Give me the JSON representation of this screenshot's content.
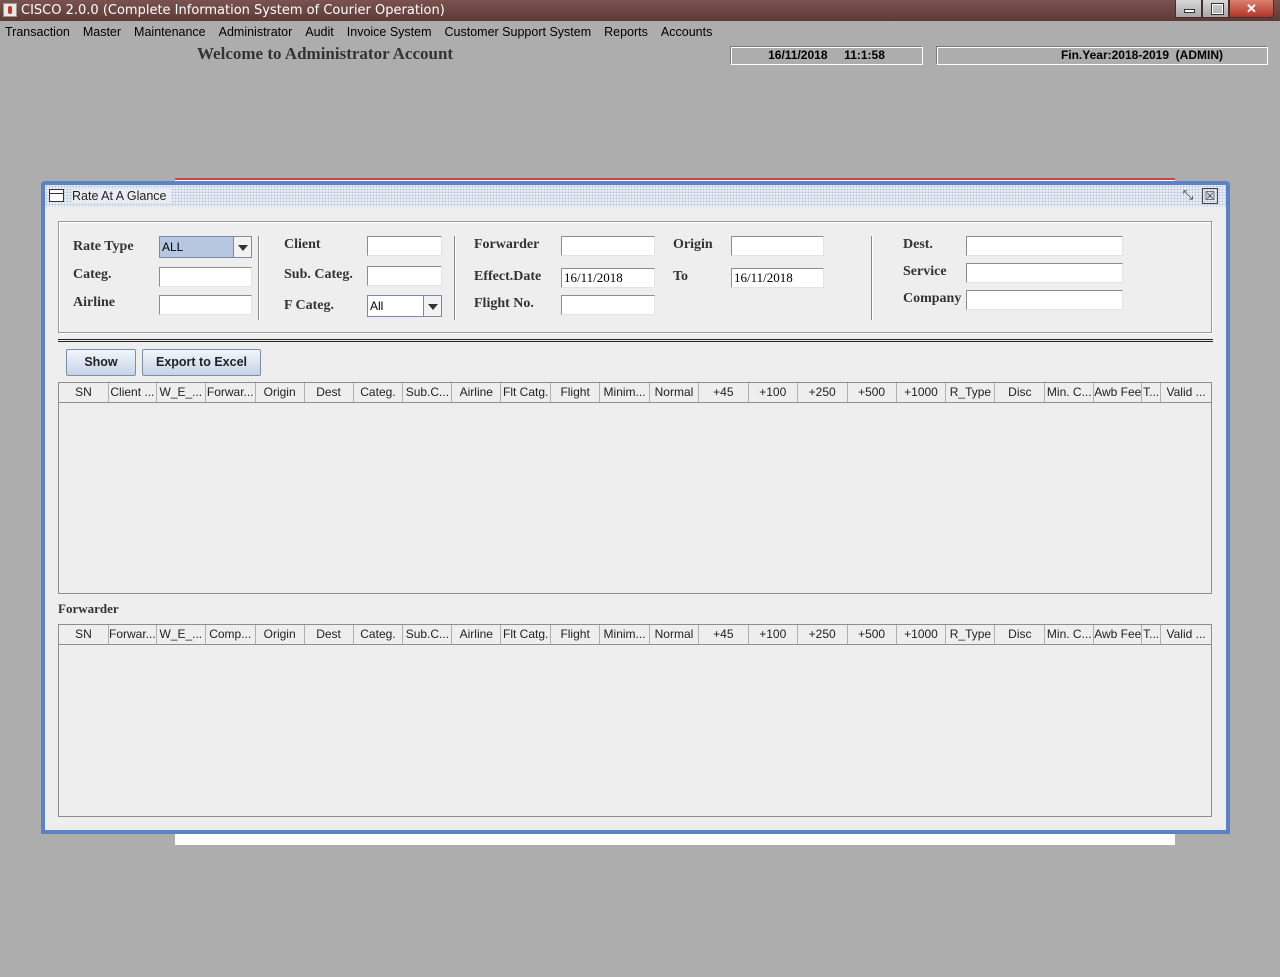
{
  "window": {
    "title": "CISCO 2.0.0 (Complete Information System of Courier Operation)",
    "close_glyph": "✕"
  },
  "menu": [
    "Transaction",
    "Master",
    "Maintenance",
    "Administrator",
    "Audit",
    "Invoice System",
    "Customer Support System",
    "Reports",
    "Accounts"
  ],
  "welcome": "Welcome to Administrator Account",
  "status": {
    "datetime": "16/11/2018     11:1:58",
    "finyear": "Fin.Year:2018-2019  (ADMIN)"
  },
  "frame": {
    "title": "Rate At A Glance",
    "restore_glyph": "⤡",
    "close_glyph": "☒"
  },
  "filters": {
    "rate_type_label": "Rate Type",
    "rate_type_value": "ALL",
    "categ_label": "Categ.",
    "airline_label": "Airline",
    "client_label": "Client",
    "sub_categ_label": "Sub. Categ.",
    "f_categ_label": "F Categ.",
    "f_categ_value": "All",
    "forwarder_label": "Forwarder",
    "effect_date_label": "Effect.Date",
    "effect_date_value": "16/11/2018",
    "flight_no_label": "Flight No.",
    "origin_label": "Origin",
    "to_label": "To",
    "to_value": "16/11/2018",
    "dest_label": "Dest.",
    "service_label": "Service",
    "company_label": "Company"
  },
  "buttons": {
    "show": "Show",
    "export": "Export to Excel"
  },
  "client_table": {
    "columns": [
      "SN",
      "Client ...",
      "W_E_...",
      "Forwar...",
      "Origin",
      "Dest",
      "Categ.",
      "Sub.C...",
      "Airline",
      "Flt Catg.",
      "Flight",
      "Minim...",
      "Normal",
      "+45",
      "+100",
      "+250",
      "+500",
      "+1000",
      "R_Type",
      "Disc",
      "Min. C...",
      "Awb Fee",
      "T...",
      "Valid ..."
    ],
    "rows": []
  },
  "forwarder_section_label": "Forwarder",
  "forwarder_table": {
    "columns": [
      "SN",
      "Forwar...",
      "W_E_...",
      "Comp...",
      "Origin",
      "Dest",
      "Categ.",
      "Sub.C...",
      "Airline",
      "Flt Catg.",
      "Flight",
      "Minim...",
      "Normal",
      "+45",
      "+100",
      "+250",
      "+500",
      "+1000",
      "R_Type",
      "Disc",
      "Min. C...",
      "Awb Fee",
      "T...",
      "Valid ..."
    ],
    "rows": []
  }
}
